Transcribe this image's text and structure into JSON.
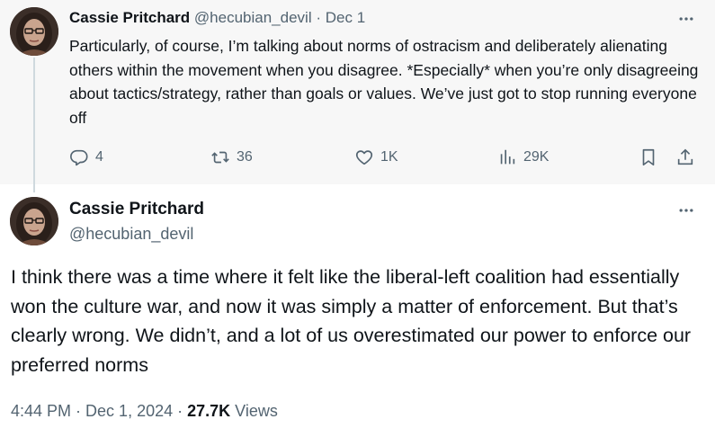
{
  "parent_tweet": {
    "author_name": "Cassie Pritchard",
    "handle": "@hecubian_devil",
    "separator": "·",
    "date": "Dec 1",
    "text": "Particularly, of course, I’m talking about norms of ostracism and deliberately alienating others within the movement when you disagree. *Especially* when you’re only disagreeing about tactics/strategy, rather than goals or values. We’ve just got to stop running everyone off",
    "replies": "4",
    "reposts": "36",
    "likes": "1K",
    "views": "29K"
  },
  "main_tweet": {
    "author_name": "Cassie Pritchard",
    "handle": "@hecubian_devil",
    "text": "I think there was a time where it felt like the liberal-left coalition had essentially won the culture war, and now it was simply a matter of enforcement. But that’s clearly wrong. We didn’t, and a lot of us overestimated our power to enforce our preferred norms",
    "time": "4:44 PM",
    "separator1": " · ",
    "date": "Dec 1, 2024",
    "separator2": " · ",
    "views_count": "27.7K",
    "views_label": " Views"
  },
  "icons": {
    "more": "more-horizontal-icon",
    "reply": "reply-bubble-icon",
    "repost": "repost-icon",
    "like": "heart-icon",
    "views": "bar-chart-icon",
    "bookmark": "bookmark-icon",
    "share": "share-icon"
  },
  "colors": {
    "text_primary": "#0f1419",
    "text_secondary": "#536471",
    "parent_background": "#f7f7f7",
    "thread_line": "#cfd9de"
  }
}
